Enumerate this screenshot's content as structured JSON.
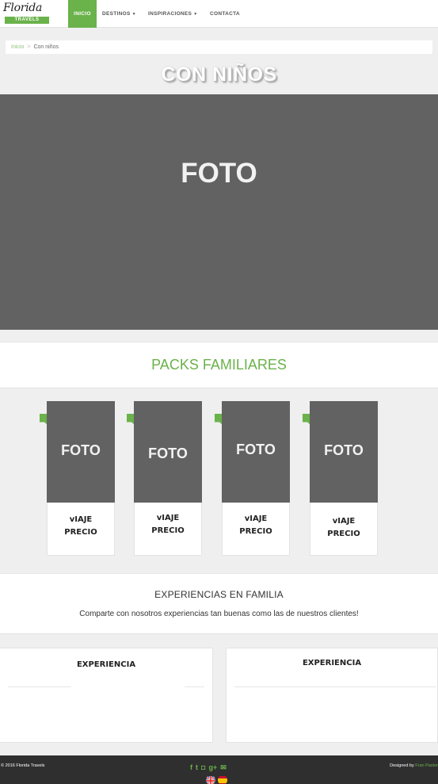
{
  "brand": {
    "script": "Florida",
    "ribbon": "TRAVELS"
  },
  "nav": {
    "items": [
      {
        "label": "INICIO",
        "active": true
      },
      {
        "label": "DESTINOS",
        "dropdown": true
      },
      {
        "label": "INSPIRACIONES",
        "dropdown": true
      },
      {
        "label": "CONTACTA"
      }
    ]
  },
  "breadcrumb": {
    "home": "Inicio",
    "separator": ">",
    "current": "Con niños"
  },
  "page": {
    "title": "CON NIÑOS"
  },
  "hero": {
    "label": "FOTO"
  },
  "packs": {
    "title": "PACKS FAMILIARES",
    "cards": [
      {
        "photo": "FOTO",
        "line1": "vIAJE",
        "line2": "PRECIO"
      },
      {
        "photo": "FOTO",
        "line1": "vIAJE",
        "line2": "PRECIO"
      },
      {
        "photo": "FOTO",
        "line1": "vIAJE",
        "line2": "PRECIO"
      },
      {
        "photo": "FOTO",
        "line1": "vIAJE",
        "line2": "PRECIO"
      }
    ]
  },
  "experiences": {
    "title": "EXPERIENCIAS EN FAMILIA",
    "subtitle": "Comparte con nosotros experiencias tan buenas como las de nuestros clientes!",
    "boxes": [
      {
        "title": "EXPERIENCIA"
      },
      {
        "title": "EXPERIENCIA"
      }
    ]
  },
  "footer": {
    "copyright": "© 2016 Florida Travels",
    "designed_prefix": "Designed by",
    "designed_author": "Fran Pastor",
    "social_icons": [
      "facebook-icon",
      "twitter-icon",
      "instagram-icon",
      "google-plus-icon",
      "envelope-icon"
    ],
    "social_glyphs": [
      "f",
      "t",
      "◘",
      "g+",
      "✉"
    ]
  },
  "colors": {
    "accent": "#6ab24a",
    "photo_placeholder": "#626262",
    "footer_bg": "#2f2f2f"
  }
}
